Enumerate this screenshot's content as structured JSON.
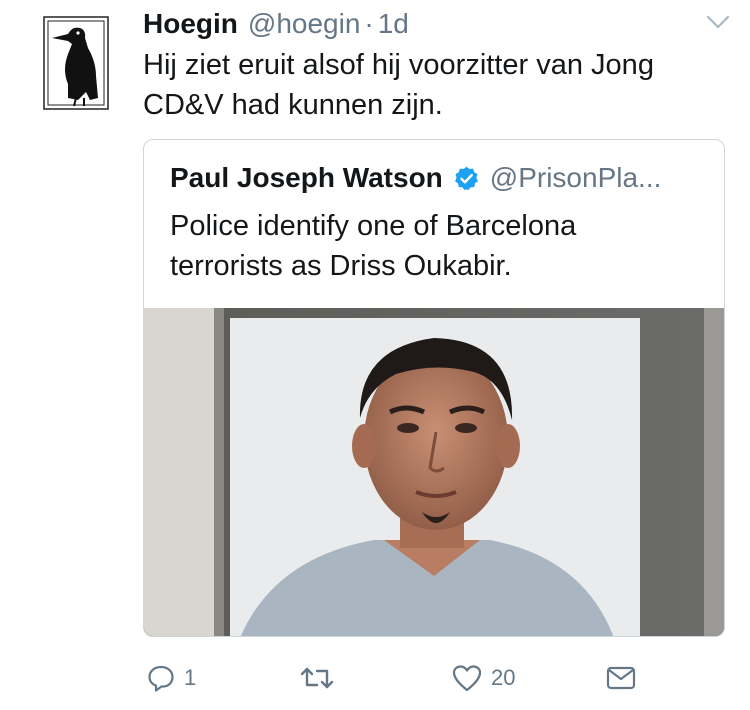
{
  "tweet": {
    "display_name": "Hoegin",
    "handle": "@hoegin",
    "separator": "·",
    "time": "1d",
    "text": "Hij ziet eruit alsof hij voorzitter van Jong CD&V had kunnen zijn."
  },
  "quoted_tweet": {
    "display_name": "Paul Joseph Watson",
    "handle": "@PrisonPla...",
    "text": "Police identify one of Barcelona terrorists as Driss Oukabir.",
    "image_description": "mugshot-photo"
  },
  "actions": {
    "reply_count": "1",
    "retweet_count": "",
    "like_count": "20"
  },
  "icons": {
    "avatar": "crow-logo-icon",
    "caret": "chevron-down-icon",
    "verified": "verified-badge-icon",
    "reply": "reply-icon",
    "retweet": "retweet-icon",
    "like": "heart-icon",
    "message": "envelope-icon"
  },
  "colors": {
    "text": "#14171a",
    "secondary": "#657786",
    "verified": "#1da1f2",
    "border": "#ccd6dd"
  }
}
